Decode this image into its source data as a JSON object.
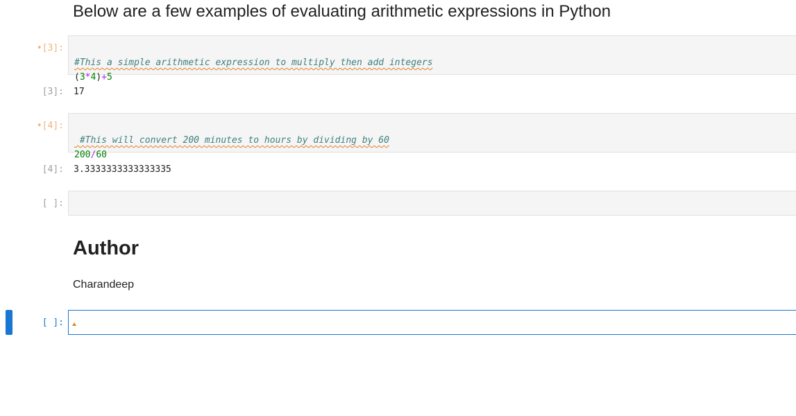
{
  "heading_examples": "Below are a few examples of evaluating arithmetic expressions in Python",
  "cells": [
    {
      "prompt": "•[3]:",
      "comment": "#This a simple arithmetic expression to multiply then add integers",
      "code_tokens": [
        {
          "t": "(",
          "k": "punc"
        },
        {
          "t": "3",
          "k": "num"
        },
        {
          "t": "*",
          "k": "op"
        },
        {
          "t": "4",
          "k": "num"
        },
        {
          "t": ")",
          "k": "punc"
        },
        {
          "t": "+",
          "k": "op"
        },
        {
          "t": "5",
          "k": "num"
        }
      ],
      "output_prompt": "[3]:",
      "output": "17"
    },
    {
      "prompt": "•[4]:",
      "comment": " #This will convert 200 minutes to hours by dividing by 60",
      "code_tokens": [
        {
          "t": "200",
          "k": "num"
        },
        {
          "t": "/",
          "k": "op"
        },
        {
          "t": "60",
          "k": "num"
        }
      ],
      "output_prompt": "[4]:",
      "output": "3.3333333333333335"
    }
  ],
  "empty_cell_prompt": "[ ]:",
  "author_heading": "Author",
  "author_name": "Charandeep",
  "active_cell_prompt": "[ ]:",
  "colors": {
    "accent": "#1976d2",
    "dirty_prompt": "#f0b27a",
    "comment": "#408080",
    "number": "#008000",
    "operator": "#aa22ff"
  }
}
